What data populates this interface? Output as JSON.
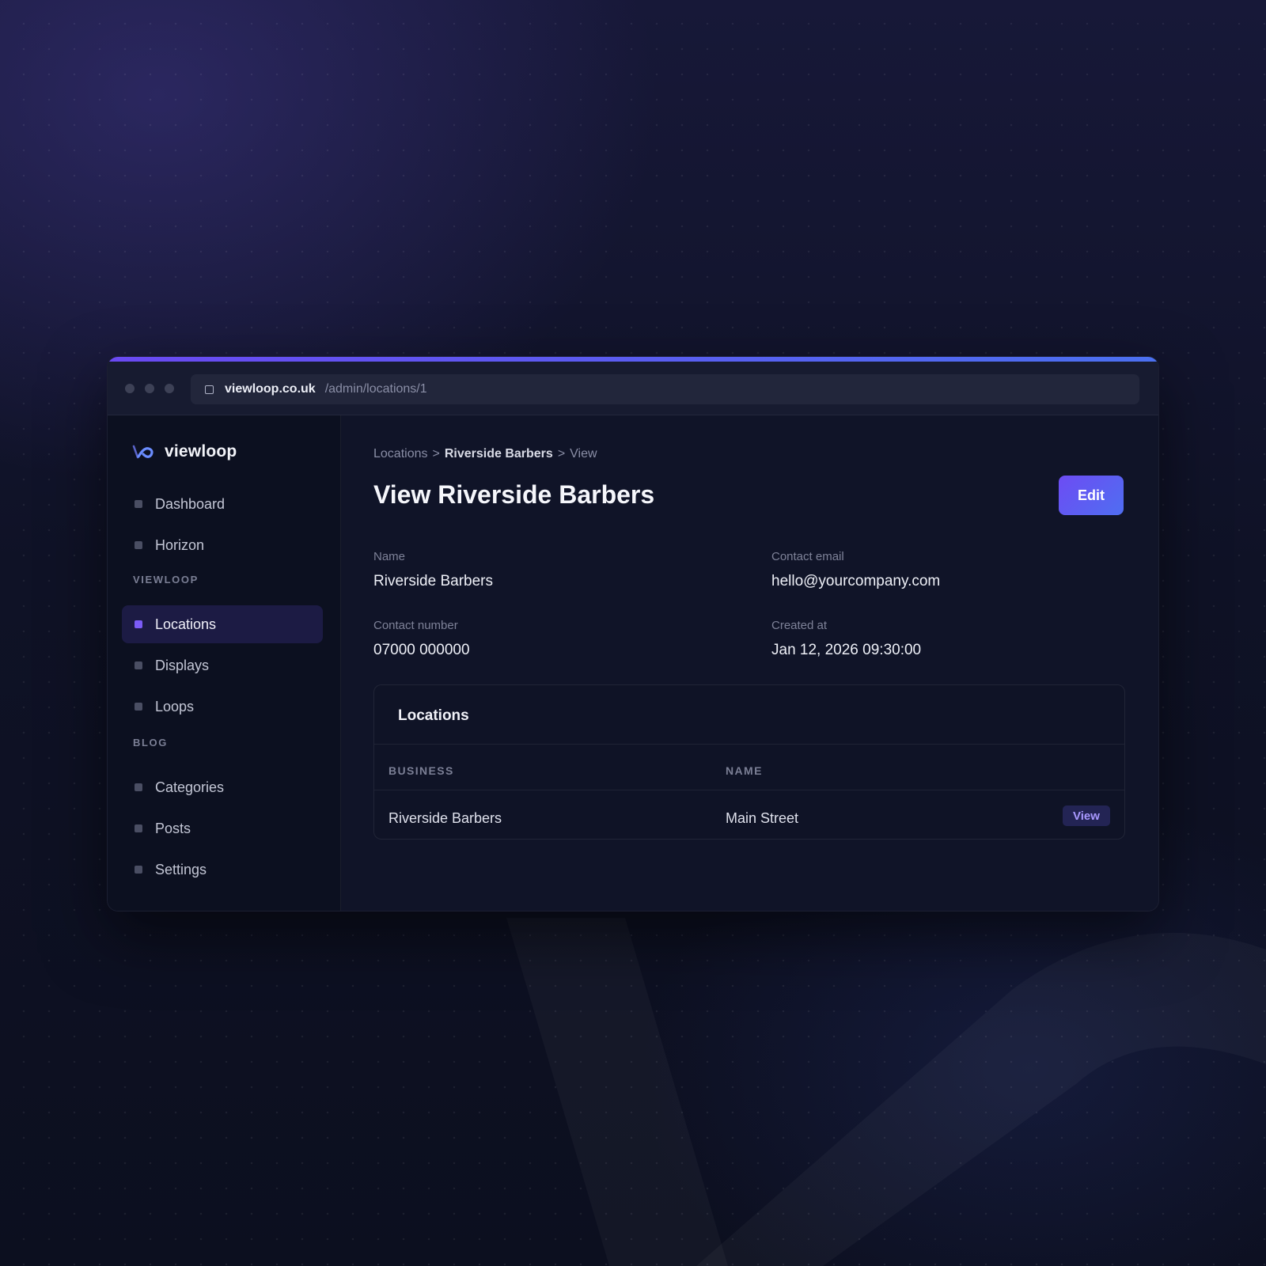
{
  "browser": {
    "domain": "viewloop.co.uk",
    "path": "/admin/locations/1"
  },
  "brand": {
    "name": "viewloop"
  },
  "sidebar": {
    "items_top": [
      {
        "label": "Dashboard"
      },
      {
        "label": "Horizon"
      }
    ],
    "section_viewloop": "VIEWLOOP",
    "items_viewloop": [
      {
        "label": "Locations",
        "active": true
      },
      {
        "label": "Displays"
      },
      {
        "label": "Loops"
      }
    ],
    "section_blog": "BLOG",
    "items_blog": [
      {
        "label": "Categories"
      },
      {
        "label": "Posts"
      },
      {
        "label": "Settings"
      }
    ]
  },
  "breadcrumb": {
    "first": "Locations",
    "second": "Riverside Barbers",
    "third": "View",
    "separator": ">"
  },
  "page": {
    "title": "View Riverside Barbers",
    "edit_label": "Edit"
  },
  "details": {
    "name_label": "Name",
    "name_value": "Riverside Barbers",
    "email_label": "Contact email",
    "email_value": "hello@yourcompany.com",
    "phone_label": "Contact number",
    "phone_value": "07000 000000",
    "created_label": "Created at",
    "created_value": "Jan 12, 2026 09:30:00"
  },
  "locations_table": {
    "title": "Locations",
    "columns": [
      "BUSINESS",
      "NAME"
    ],
    "rows": [
      {
        "business": "Riverside Barbers",
        "name": "Main Street",
        "action": "View"
      }
    ]
  },
  "colors": {
    "accent_purple": "#6d4cf3",
    "accent_blue": "#4f6ef2",
    "background": "#0d1020"
  }
}
